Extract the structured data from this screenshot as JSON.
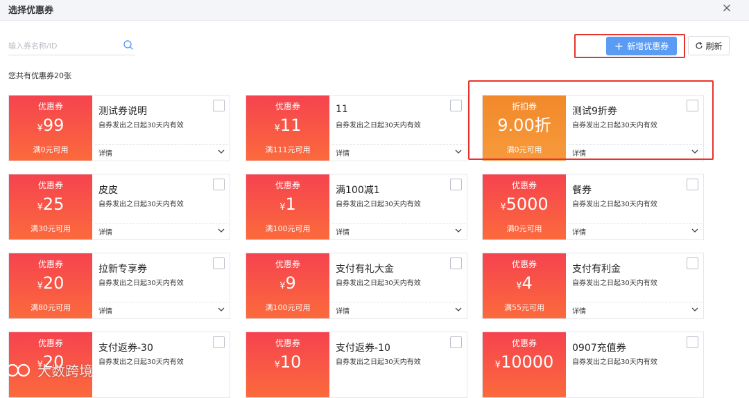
{
  "dialog": {
    "title": "选择优惠券",
    "close_label": "×"
  },
  "search": {
    "placeholder": "输入券名称/ID",
    "value": ""
  },
  "toolbar": {
    "add_label": "新增优惠券",
    "refresh_label": "刷新"
  },
  "summary": {
    "count_text": "您共有优惠券20张"
  },
  "colors": {
    "coupon_red": "#f6434f",
    "discount_orange": "#f2892b",
    "primary_blue": "#5a9cf3",
    "highlight_red": "#e8322d"
  },
  "coupons": [
    {
      "type": "优惠券",
      "currency": "¥",
      "amount": "99",
      "condition": "满0元可用",
      "name": "测试券说明",
      "validity": "自券发出之日起30天内有效",
      "detail": "详情"
    },
    {
      "type": "优惠券",
      "currency": "¥",
      "amount": "11",
      "condition": "满111元可用",
      "name": "11",
      "validity": "自券发出之日起30天内有效",
      "detail": "详情"
    },
    {
      "type": "折扣券",
      "currency": "",
      "amount": "9.00折",
      "condition": "满0元可用",
      "name": "测试9折券",
      "validity": "自券发出之日起30天内有效",
      "detail": "详情"
    },
    {
      "type": "优惠券",
      "currency": "¥",
      "amount": "25",
      "condition": "满30元可用",
      "name": "皮皮",
      "validity": "自券发出之日起30天内有效",
      "detail": "详情"
    },
    {
      "type": "优惠券",
      "currency": "¥",
      "amount": "1",
      "condition": "满100元可用",
      "name": "满100减1",
      "validity": "自券发出之日起30天内有效",
      "detail": "详情"
    },
    {
      "type": "优惠券",
      "currency": "¥",
      "amount": "5000",
      "condition": "满0元可用",
      "name": "餐券",
      "validity": "自券发出之日起30天内有效",
      "detail": "详情"
    },
    {
      "type": "优惠券",
      "currency": "¥",
      "amount": "20",
      "condition": "满80元可用",
      "name": "拉新专享券",
      "validity": "自券发出之日起30天内有效",
      "detail": "详情"
    },
    {
      "type": "优惠券",
      "currency": "¥",
      "amount": "9",
      "condition": "满100元可用",
      "name": "支付有礼大金",
      "validity": "自券发出之日起30天内有效",
      "detail": "详情"
    },
    {
      "type": "优惠券",
      "currency": "¥",
      "amount": "4",
      "condition": "满55元可用",
      "name": "支付有利金",
      "validity": "自券发出之日起30天内有效",
      "detail": "详情"
    },
    {
      "type": "优惠券",
      "currency": "¥",
      "amount": "20",
      "condition": "",
      "name": "支付返券-30",
      "validity": "自券发出之日起30天内有效",
      "detail": ""
    },
    {
      "type": "优惠券",
      "currency": "¥",
      "amount": "10",
      "condition": "",
      "name": "支付返券-10",
      "validity": "自券发出之日起30天内有效",
      "detail": ""
    },
    {
      "type": "优惠券",
      "currency": "¥",
      "amount": "10000",
      "condition": "",
      "name": "0907充值券",
      "validity": "自券发出之日起30天内有效",
      "detail": ""
    }
  ],
  "watermark": {
    "text": "大数跨境"
  }
}
